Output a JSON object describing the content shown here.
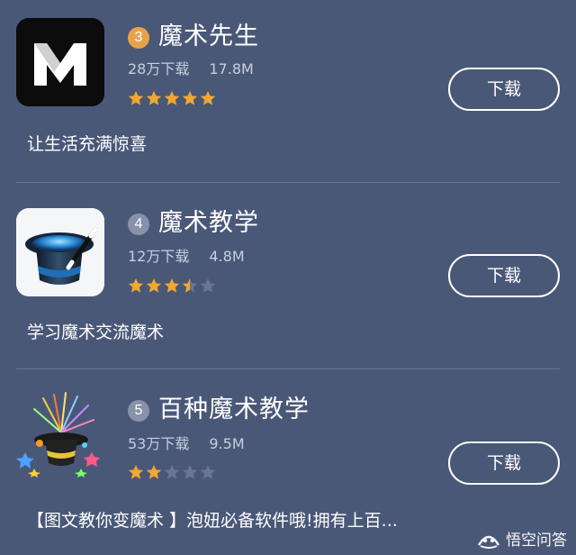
{
  "apps": [
    {
      "rank": "3",
      "rank_color": "#e8a34a",
      "name": "魔术先生",
      "downloads": "28万下载",
      "size": "17.8M",
      "rating": 5,
      "button": "下载",
      "description": "让生活充满惊喜",
      "icon": "magic-m-logo-icon"
    },
    {
      "rank": "4",
      "rank_color": "#8892a8",
      "name": "魔术教学",
      "downloads": "12万下载",
      "size": "4.8M",
      "rating": 3.5,
      "button": "下载",
      "description": "学习魔术交流魔术",
      "icon": "magic-hat-wand-icon"
    },
    {
      "rank": "5",
      "rank_color": "#8892a8",
      "name": "百种魔术教学",
      "downloads": "53万下载",
      "size": "9.5M",
      "rating": 2,
      "button": "下载",
      "description": "【图文教你变魔术 】泡妞必备软件哦!拥有上百...",
      "icon": "magic-hat-fireworks-icon"
    }
  ],
  "colors": {
    "background": "#4a5878",
    "star_filled": "#f0a830",
    "star_empty": "#6b7690"
  },
  "watermark": {
    "text": "悟空问答"
  }
}
